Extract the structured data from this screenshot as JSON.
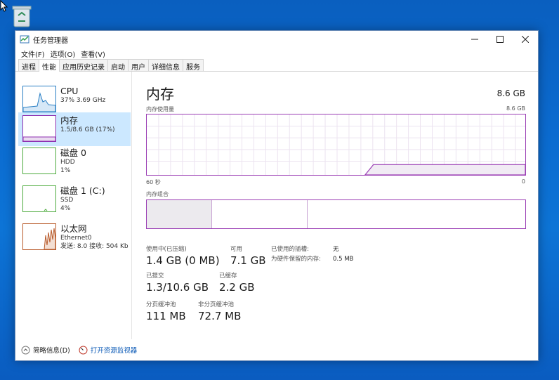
{
  "window": {
    "title": "任务管理器"
  },
  "menu": [
    "文件(F)",
    "选项(O)",
    "查看(V)"
  ],
  "tabs": [
    "进程",
    "性能",
    "应用历史记录",
    "启动",
    "用户",
    "详细信息",
    "服务"
  ],
  "active_tab_index": 1,
  "sidebar": {
    "items": [
      {
        "name": "CPU",
        "line1": "37% 3.69 GHz",
        "line2": "",
        "color": "#2a7fc4"
      },
      {
        "name": "内存",
        "line1": "1.5/8.6 GB (17%)",
        "line2": "",
        "color": "#8e2fb0"
      },
      {
        "name": "磁盘 0",
        "line1": "HDD",
        "line2": "1%",
        "color": "#4caa3c"
      },
      {
        "name": "磁盘 1 (C:)",
        "line1": "SSD",
        "line2": "4%",
        "color": "#4caa3c"
      },
      {
        "name": "以太网",
        "line1": "Ethernet0",
        "line2": "发送: 8.0  接收: 504 Kb",
        "color": "#b85a2a"
      }
    ]
  },
  "main": {
    "title": "内存",
    "total": "8.6 GB",
    "usage_label": "内存使用量",
    "usage_max": "8.6 GB",
    "time_left": "60 秒",
    "time_right": "0",
    "composition_label": "内存组合",
    "in_use_label": "使用中(已压缩)",
    "in_use_value": "1.4 GB (0 MB)",
    "available_label": "可用",
    "available_value": "7.1 GB",
    "slots_label": "已使用的插槽:",
    "slots_value": "无",
    "reserved_label": "为硬件保留的内存:",
    "reserved_value": "0.5 MB",
    "committed_label": "已提交",
    "committed_value": "1.3/10.6 GB",
    "cached_label": "已缓存",
    "cached_value": "2.2 GB",
    "paged_label": "分页缓冲池",
    "paged_value": "111 MB",
    "nonpaged_label": "非分页缓冲池",
    "nonpaged_value": "72.7 MB"
  },
  "footer": {
    "less_details": "简略信息(D)",
    "open_monitor": "打开资源监视器"
  },
  "colors": {
    "memory": "#9b3fb5",
    "accent": "#0a59b6"
  }
}
